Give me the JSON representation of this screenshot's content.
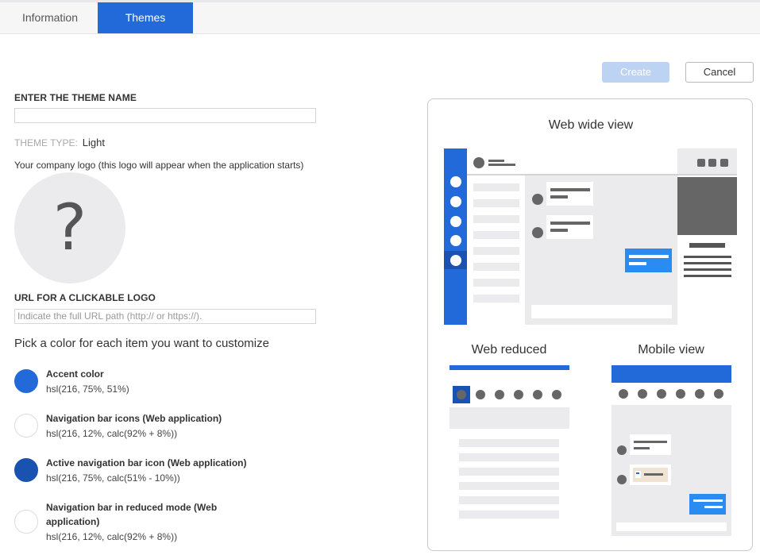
{
  "tabs": [
    {
      "label": "Information",
      "active": false
    },
    {
      "label": "Themes",
      "active": true
    }
  ],
  "actions": {
    "create_label": "Create",
    "cancel_label": "Cancel"
  },
  "form": {
    "theme_name_label": "ENTER THE THEME NAME",
    "theme_name_value": "",
    "theme_type_label": "THEME TYPE:",
    "theme_type_value": "Light",
    "logo_caption": "Your company logo (this logo will appear when the application starts)",
    "logo_placeholder": "?",
    "url_label": "URL FOR A CLICKABLE LOGO",
    "url_placeholder": "Indicate the full URL path (http:// or https://).",
    "pick_heading": "Pick a color for each item you want to customize"
  },
  "colors": [
    {
      "title": "Accent color",
      "value": "hsl(216, 75%, 51%)",
      "swatch": "#2269d9"
    },
    {
      "title": "Navigation bar icons (Web application)",
      "value": "hsl(216, 12%, calc(92% + 8%))",
      "swatch": "#ffffff"
    },
    {
      "title": "Active navigation bar icon (Web application)",
      "value": "hsl(216, 75%, calc(51% - 10%))",
      "swatch": "#1a52b1"
    },
    {
      "title": "Navigation bar in reduced mode (Web application)",
      "value": "hsl(216, 12%, calc(92% + 8%))",
      "swatch": "#ffffff"
    }
  ],
  "preview": {
    "wide_title": "Web wide view",
    "reduced_title": "Web reduced",
    "mobile_title": "Mobile view"
  },
  "palette": {
    "accent": "#2269d9",
    "active": "#1a52b1",
    "bubble": "#2a8cf0"
  }
}
